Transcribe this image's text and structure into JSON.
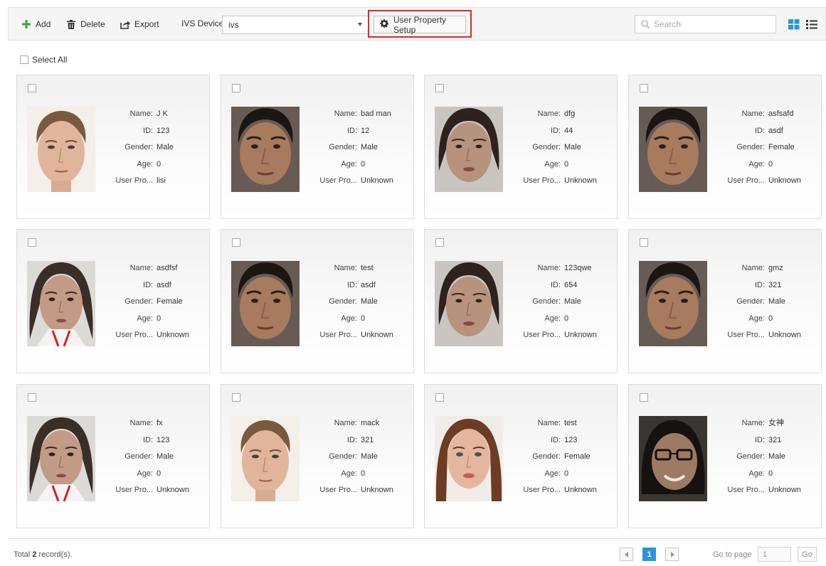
{
  "toolbar": {
    "add_label": "Add",
    "delete_label": "Delete",
    "export_label": "Export",
    "ivs_device_label": "IVS Device:",
    "ivs_device_value": "ivs",
    "user_property_setup_label": "User Property Setup",
    "search_placeholder": "Search"
  },
  "select_all_label": "Select All",
  "field_labels": {
    "name": "Name:",
    "id": "ID:",
    "gender": "Gender:",
    "age": "Age:",
    "user_property": "User Pro..."
  },
  "cards": [
    {
      "name": "J K",
      "id": "123",
      "gender": "Male",
      "age": "0",
      "user_property": "lisi"
    },
    {
      "name": "bad man",
      "id": "12",
      "gender": "Male",
      "age": "0",
      "user_property": "Unknown"
    },
    {
      "name": "dfg",
      "id": "44",
      "gender": "Male",
      "age": "0",
      "user_property": "Unknown"
    },
    {
      "name": "asfsafd",
      "id": "asdf",
      "gender": "Female",
      "age": "0",
      "user_property": "Unknown"
    },
    {
      "name": "asdfsf",
      "id": "asdf",
      "gender": "Female",
      "age": "0",
      "user_property": "Unknown"
    },
    {
      "name": "test",
      "id": "asdf",
      "gender": "Male",
      "age": "0",
      "user_property": "Unknown"
    },
    {
      "name": "123qwe",
      "id": "654",
      "gender": "Male",
      "age": "0",
      "user_property": "Unknown"
    },
    {
      "name": "gmz",
      "id": "321",
      "gender": "Male",
      "age": "0",
      "user_property": "Unknown"
    },
    {
      "name": "fx",
      "id": "123",
      "gender": "Male",
      "age": "0",
      "user_property": "Unknown"
    },
    {
      "name": "mack",
      "id": "321",
      "gender": "Male",
      "age": "0",
      "user_property": "Unknown"
    },
    {
      "name": "test",
      "id": "123",
      "gender": "Female",
      "age": "0",
      "user_property": "Unknown"
    },
    {
      "name": "女神",
      "id": "321",
      "gender": "Male",
      "age": "0",
      "user_property": "Unknown"
    }
  ],
  "footer": {
    "total_prefix": "Total",
    "total_count": "2",
    "total_suffix": "record(s).",
    "current_page": "1",
    "goto_label": "Go to page",
    "goto_value": "1",
    "go_label": "Go"
  },
  "colors": {
    "accent_blue": "#2b95dc",
    "add_green": "#3aa63a",
    "highlight_red": "#e0262b"
  }
}
